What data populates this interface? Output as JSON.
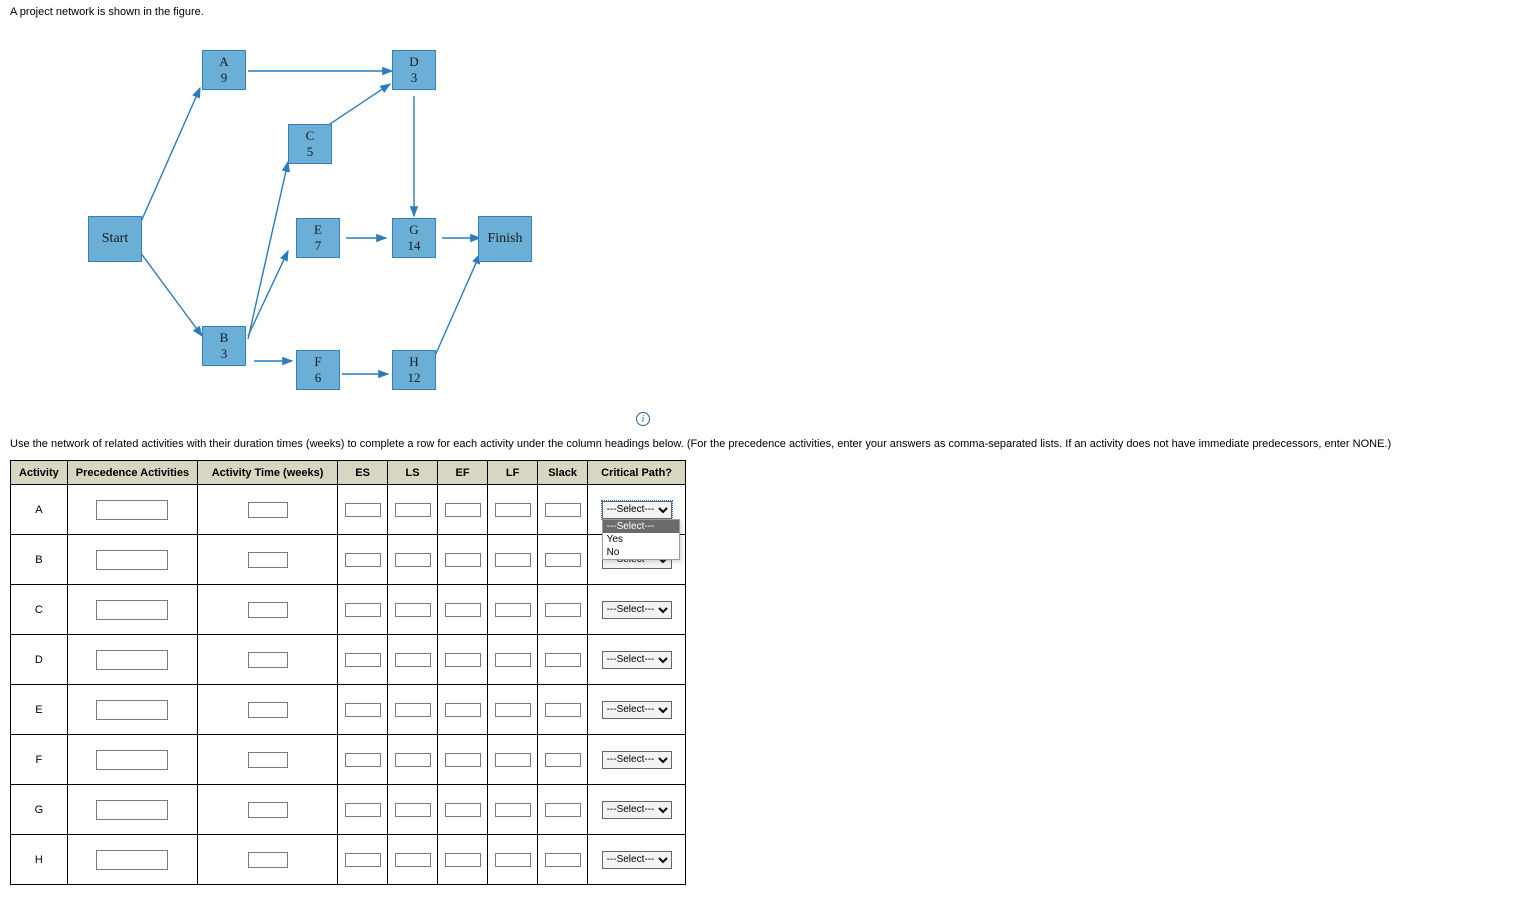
{
  "intro": "A project network is shown in the figure.",
  "instructions": "Use the network of related activities with their duration times (weeks) to complete a row for each activity under the column headings below. (For the precedence activities, enter your answers as comma-separated lists. If an activity does not have immediate predecessors, enter NONE.)",
  "diagram": {
    "nodes": {
      "start": {
        "label": "Start"
      },
      "finish": {
        "label": "Finish"
      },
      "A": {
        "letter": "A",
        "duration": "9"
      },
      "B": {
        "letter": "B",
        "duration": "3"
      },
      "C": {
        "letter": "C",
        "duration": "5"
      },
      "D": {
        "letter": "D",
        "duration": "3"
      },
      "E": {
        "letter": "E",
        "duration": "7"
      },
      "F": {
        "letter": "F",
        "duration": "6"
      },
      "G": {
        "letter": "G",
        "duration": "14"
      },
      "H": {
        "letter": "H",
        "duration": "12"
      }
    },
    "info_tooltip": "i"
  },
  "table": {
    "headers": {
      "activity": "Activity",
      "precedence": "Precedence Activities",
      "time": "Activity Time (weeks)",
      "es": "ES",
      "ls": "LS",
      "ef": "EF",
      "lf": "LF",
      "slack": "Slack",
      "critical": "Critical Path?"
    },
    "rows": [
      {
        "activity": "A"
      },
      {
        "activity": "B"
      },
      {
        "activity": "C"
      },
      {
        "activity": "D"
      },
      {
        "activity": "E"
      },
      {
        "activity": "F"
      },
      {
        "activity": "G"
      },
      {
        "activity": "H"
      }
    ],
    "select_placeholder": "---Select---",
    "select_options": [
      "---Select---",
      "Yes",
      "No"
    ],
    "open_dropdown_row": "A"
  }
}
